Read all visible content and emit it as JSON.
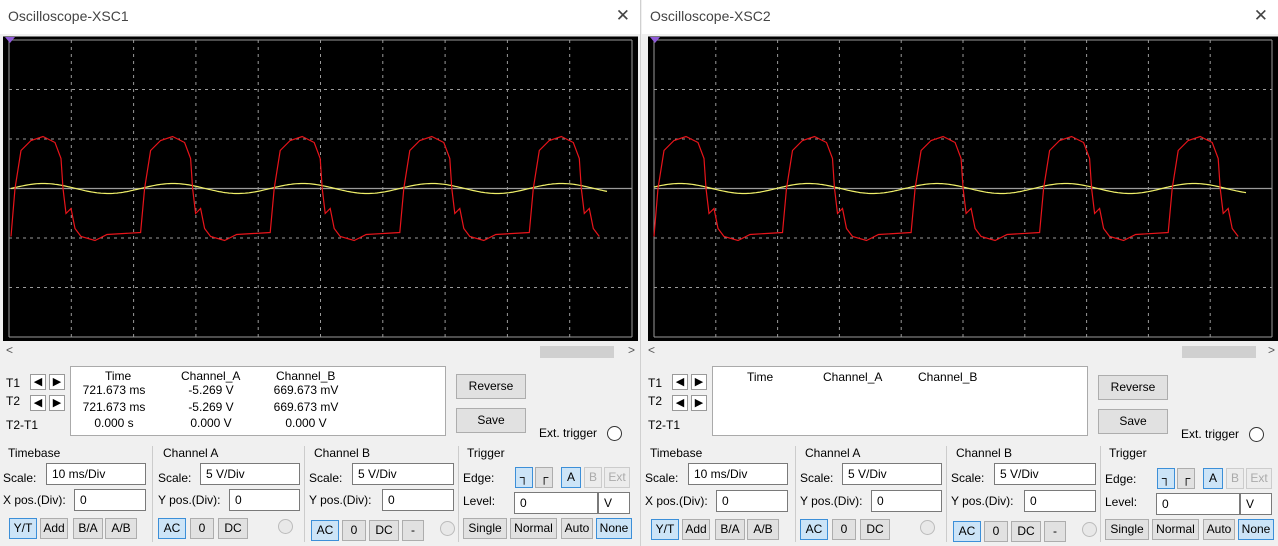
{
  "colors": {
    "screen_bg": "#000000",
    "grid": "#9a9a9a",
    "channel_a": "#e8141a",
    "channel_b": "#f0f06a",
    "t1_marker": "#8f5ad8"
  },
  "windows": [
    {
      "title": "Oscilloscope-XSC1",
      "close": "✕",
      "cursors": {
        "t1": "T1",
        "t2": "T2",
        "t2t1": "T2-T1"
      },
      "readout": {
        "headers": [
          "Time",
          "Channel_A",
          "Channel_B"
        ],
        "rows": [
          [
            "721.673 ms",
            "-5.269 V",
            "669.673 mV"
          ],
          [
            "721.673 ms",
            "-5.269 V",
            "669.673 mV"
          ],
          [
            "0.000 s",
            "0.000 V",
            "0.000 V"
          ]
        ]
      },
      "buttons": {
        "reverse": "Reverse",
        "save": "Save"
      },
      "ext_trigger": "Ext. trigger",
      "timebase": {
        "title": "Timebase",
        "scale_label": "Scale:",
        "scale": "10 ms/Div",
        "pos_label": "X pos.(Div):",
        "pos": "0",
        "modes": [
          "Y/T",
          "Add",
          "B/A",
          "A/B"
        ]
      },
      "channel_a": {
        "title": "Channel A",
        "scale_label": "Scale:",
        "scale": "5  V/Div",
        "pos_label": "Y pos.(Div):",
        "pos": "0",
        "coupling": [
          "AC",
          "0",
          "DC"
        ]
      },
      "channel_b": {
        "title": "Channel B",
        "scale_label": "Scale:",
        "scale": "5  V/Div",
        "pos_label": "Y pos.(Div):",
        "pos": "0",
        "coupling": [
          "AC",
          "0",
          "DC",
          "-"
        ]
      },
      "trigger": {
        "title": "Trigger",
        "edge_label": "Edge:",
        "sources": [
          "A",
          "B",
          "Ext"
        ],
        "level_label": "Level:",
        "level": "0",
        "unit": "V",
        "modes": [
          "Single",
          "Normal",
          "Auto",
          "None"
        ]
      }
    },
    {
      "title": "Oscilloscope-XSC2",
      "close": "✕",
      "cursors": {
        "t1": "T1",
        "t2": "T2",
        "t2t1": "T2-T1"
      },
      "readout": {
        "headers": [
          "Time",
          "Channel_A",
          "Channel_B"
        ],
        "rows": []
      },
      "buttons": {
        "reverse": "Reverse",
        "save": "Save"
      },
      "ext_trigger": "Ext. trigger",
      "timebase": {
        "title": "Timebase",
        "scale_label": "Scale:",
        "scale": "10 ms/Div",
        "pos_label": "X pos.(Div):",
        "pos": "0",
        "modes": [
          "Y/T",
          "Add",
          "B/A",
          "A/B"
        ]
      },
      "channel_a": {
        "title": "Channel A",
        "scale_label": "Scale:",
        "scale": "5  V/Div",
        "pos_label": "Y pos.(Div):",
        "pos": "0",
        "coupling": [
          "AC",
          "0",
          "DC"
        ]
      },
      "channel_b": {
        "title": "Channel B",
        "scale_label": "Scale:",
        "scale": "5  V/Div",
        "pos_label": "Y pos.(Div):",
        "pos": "0",
        "coupling": [
          "AC",
          "0",
          "DC",
          "-"
        ]
      },
      "trigger": {
        "title": "Trigger",
        "edge_label": "Edge:",
        "sources": [
          "A",
          "B",
          "Ext"
        ],
        "level_label": "Level:",
        "level": "0",
        "unit": "V",
        "modes": [
          "Single",
          "Normal",
          "Auto",
          "None"
        ]
      }
    }
  ]
}
